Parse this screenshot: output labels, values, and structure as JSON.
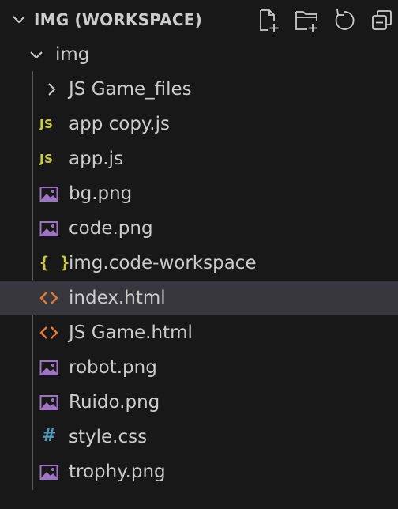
{
  "explorer": {
    "title": "IMG (WORKSPACE)",
    "actions": [
      {
        "name": "new-file-button",
        "icon": "new-file-icon"
      },
      {
        "name": "new-folder-button",
        "icon": "new-folder-icon"
      },
      {
        "name": "refresh-button",
        "icon": "refresh-icon"
      },
      {
        "name": "collapse-all-button",
        "icon": "collapse-all-icon"
      }
    ]
  },
  "tree": {
    "root": {
      "label": "img",
      "expanded": true
    },
    "items": [
      {
        "label": "JS Game_files",
        "type": "folder",
        "icon": "chevron-right-icon"
      },
      {
        "label": "app copy.js",
        "type": "js",
        "icon": "js-icon",
        "icon_text": "JS"
      },
      {
        "label": "app.js",
        "type": "js",
        "icon": "js-icon",
        "icon_text": "JS"
      },
      {
        "label": "bg.png",
        "type": "image",
        "icon": "image-icon"
      },
      {
        "label": "code.png",
        "type": "image",
        "icon": "image-icon"
      },
      {
        "label": "img.code-workspace",
        "type": "json",
        "icon": "braces-icon",
        "icon_text": "{ }"
      },
      {
        "label": "index.html",
        "type": "html",
        "icon": "html-icon",
        "selected": true
      },
      {
        "label": "JS Game.html",
        "type": "html",
        "icon": "html-icon"
      },
      {
        "label": "robot.png",
        "type": "image",
        "icon": "image-icon"
      },
      {
        "label": "Ruido.png",
        "type": "image",
        "icon": "image-icon"
      },
      {
        "label": "style.css",
        "type": "css",
        "icon": "hash-icon",
        "icon_text": "#"
      },
      {
        "label": "trophy.png",
        "type": "image",
        "icon": "image-icon"
      }
    ]
  },
  "colors": {
    "background": "#181818",
    "selected_row": "#37373d",
    "text": "#cccccc",
    "js_yellow": "#cbcb41",
    "image_purple": "#a074c4",
    "html_orange": "#e37933",
    "css_blue": "#519aba"
  }
}
